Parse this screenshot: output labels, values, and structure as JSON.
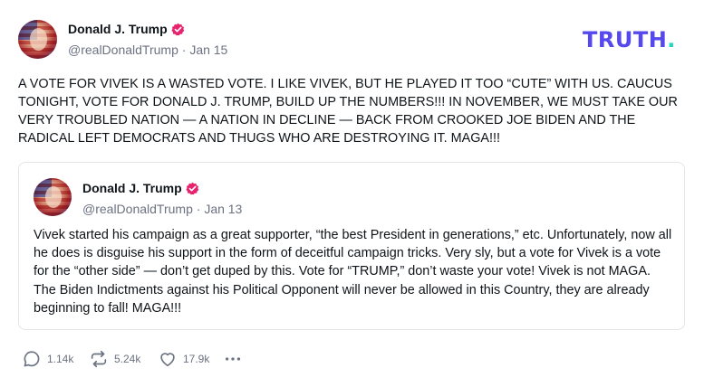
{
  "post": {
    "author": {
      "name": "Donald J. Trump",
      "handle": "@realDonaldTrump",
      "separator": "·",
      "date": "Jan 15"
    },
    "text": "A VOTE FOR VIVEK IS A WASTED VOTE. I LIKE VIVEK, BUT HE PLAYED IT TOO “CUTE” WITH US. CAUCUS TONIGHT, VOTE FOR DONALD J. TRUMP, BUILD UP THE NUMBERS!!! IN NOVEMBER, WE MUST TAKE OUR VERY TROUBLED NATION — A NATION IN DECLINE  — BACK FROM CROOKED JOE BIDEN AND THE RADICAL LEFT DEMOCRATS AND THUGS WHO ARE DESTROYING IT. MAGA!!!",
    "quote": {
      "author": {
        "name": "Donald J. Trump",
        "handle": "@realDonaldTrump",
        "separator": "·",
        "date": "Jan 13"
      },
      "text": "Vivek started his campaign as a great supporter, “the best President in generations,” etc. Unfortunately, now all he does is disguise his support in the form of deceitful campaign tricks. Very sly, but a vote for Vivek is a vote for the “other side” — don’t get duped by this. Vote for “TRUMP,” don’t waste your vote! Vivek is not MAGA. The Biden Indictments against his Political Opponent will never be allowed in this Country, they are already beginning to fall! MAGA!!!"
    },
    "actions": {
      "replies": "1.14k",
      "retruths": "5.24k",
      "likes": "17.9k"
    }
  },
  "logo": {
    "text": "TRUTH",
    "dot": "."
  },
  "icons": {
    "verified": "verified-badge-icon",
    "reply": "reply-bubble-icon",
    "retruth": "retruth-arrows-icon",
    "like": "heart-icon",
    "more": "more-dots-icon"
  },
  "colors": {
    "brand": "#5448ee",
    "brand_dot": "#1fd6c3",
    "verified": "#e8236e",
    "muted_text": "#6b7280"
  }
}
